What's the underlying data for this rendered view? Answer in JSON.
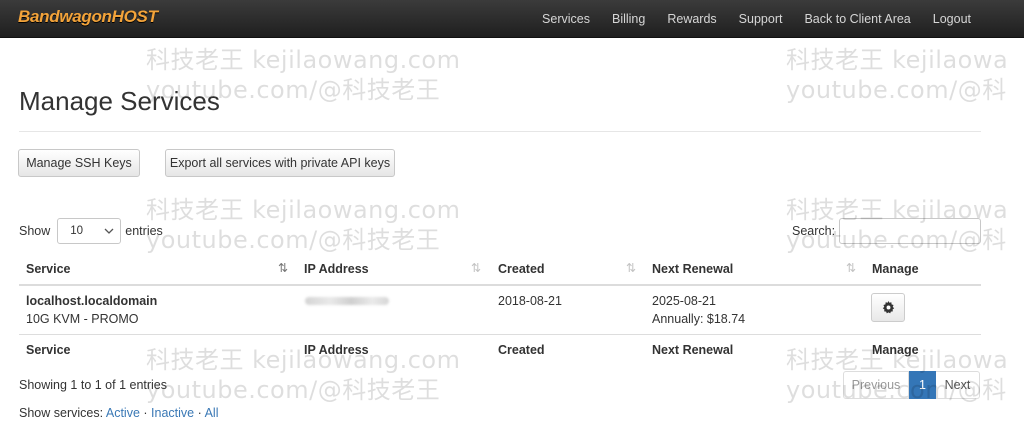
{
  "nav": {
    "brand_a": "Bandwagon",
    "brand_b": "HOST",
    "links": [
      "Services",
      "Billing",
      "Rewards",
      "Support",
      "Back to Client Area",
      "Logout"
    ]
  },
  "watermark": {
    "line1": "科技老王 kejilaowang.com",
    "line2": "youtube.com/@科技老王",
    "line1_cut": "科技老王 kejilaowa",
    "line2_cut": "youtube.com/@科"
  },
  "page": {
    "title": "Manage Services",
    "btn_ssh": "Manage SSH Keys",
    "btn_export": "Export all services with private API keys"
  },
  "controls": {
    "show_label": "Show",
    "entries_value": "10",
    "entries_label": "entries",
    "search_label": "Search:"
  },
  "table": {
    "headers": [
      "Service",
      "IP Address",
      "Created",
      "Next Renewal",
      "Manage"
    ],
    "rows": [
      {
        "service": "localhost.localdomain",
        "plan": "10G KVM - PROMO",
        "created": "2018-08-21",
        "renewal": "2025-08-21",
        "renewal_price": "Annually: $18.74"
      }
    ]
  },
  "footer": {
    "info": "Showing 1 to 1 of 1 entries",
    "prev": "Previous",
    "page": "1",
    "next": "Next",
    "show_services": "Show services:",
    "active": "Active",
    "inactive": "Inactive",
    "all": "All",
    "sep": "·"
  },
  "colors": {
    "brand": "#f3a33a",
    "link": "#3a78b5",
    "pager_active": "#3476b7"
  }
}
